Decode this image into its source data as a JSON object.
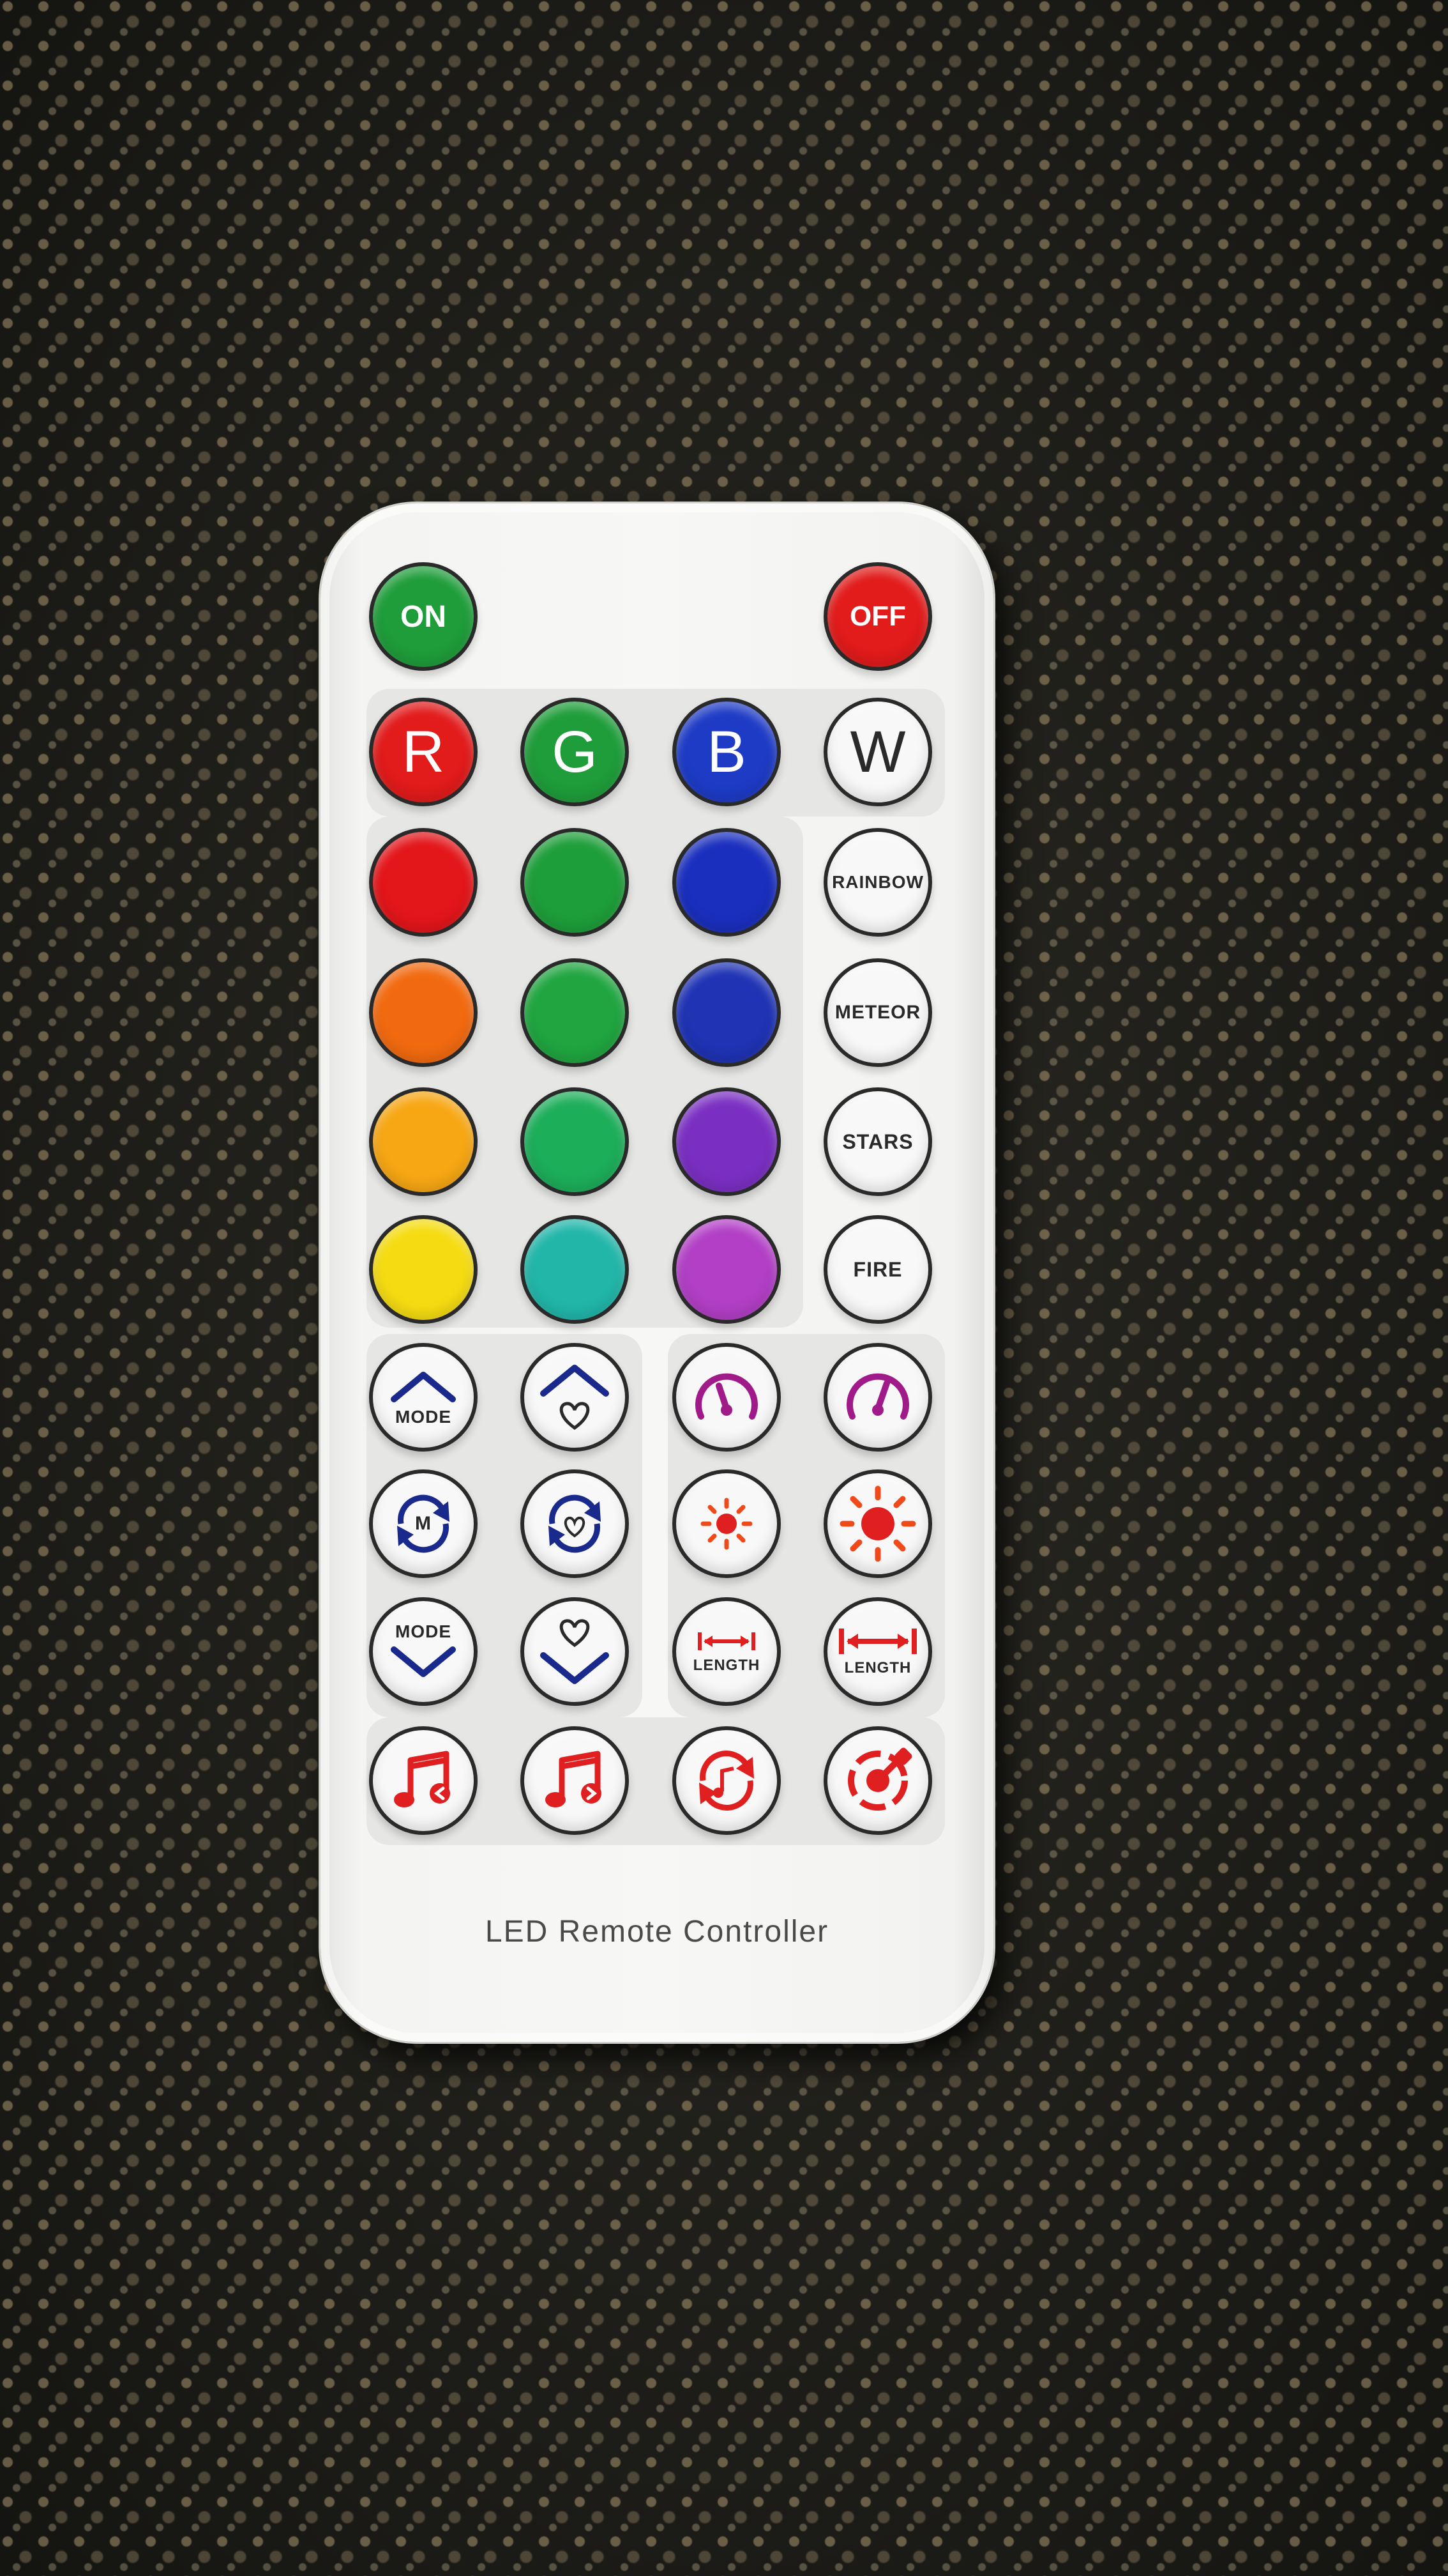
{
  "remote": {
    "footer_label": "LED Remote Controller",
    "power": {
      "on_label": "ON",
      "off_label": "OFF",
      "on_color": "#1f9d3a",
      "off_color": "#e21b1b"
    },
    "rgbw": [
      {
        "label": "R",
        "color": "#e21b1b"
      },
      {
        "label": "G",
        "color": "#1f9d3a"
      },
      {
        "label": "B",
        "color": "#1e3bc6"
      },
      {
        "label": "W",
        "color": "#f8f8f8"
      }
    ],
    "color_grid": [
      [
        "#e3161a",
        "#1e9e3a",
        "#1a2fbe"
      ],
      [
        "#f26a10",
        "#20a540",
        "#1f33b4"
      ],
      [
        "#f7a714",
        "#1dae5a",
        "#7a2fc2"
      ],
      [
        "#f5dc12",
        "#22b6a9",
        "#b23fc6"
      ]
    ],
    "effects": [
      "RAINBOW",
      "METEOR",
      "STARS",
      "FIRE"
    ],
    "mode_buttons": {
      "mode_up_label": "MODE",
      "mode_auto_label": "M",
      "mode_down_label": "MODE",
      "length_down_label": "LENGTH",
      "length_up_label": "LENGTH"
    },
    "icons": {
      "row1": [
        "mode-up-icon",
        "favorite-up-icon",
        "speed-down-icon",
        "speed-up-icon"
      ],
      "row2": [
        "mode-auto-cycle-icon",
        "favorite-cycle-icon",
        "brightness-down-icon",
        "brightness-up-icon"
      ],
      "row3": [
        "mode-down-icon",
        "favorite-down-icon",
        "length-decrease-icon",
        "length-increase-icon"
      ],
      "row4": [
        "music-prev-icon",
        "music-next-icon",
        "music-sync-icon",
        "color-picker-icon"
      ]
    },
    "accent_colors": {
      "navy": "#1a2a8c",
      "magenta": "#a01a8a",
      "red": "#e02020"
    }
  }
}
